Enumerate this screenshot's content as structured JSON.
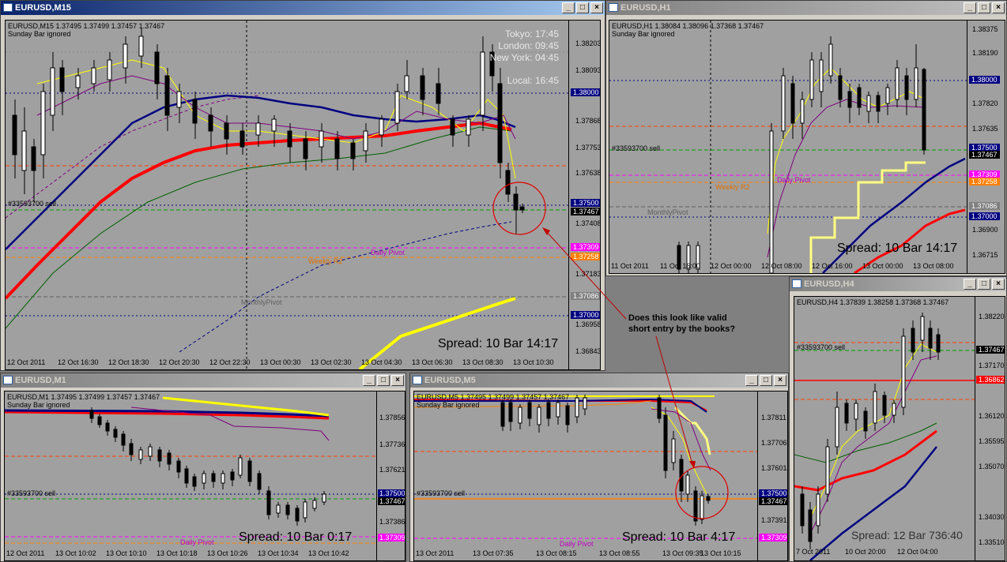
{
  "annotation": {
    "line1": "Does this look like valid",
    "line2": "short entry by the books?"
  },
  "windows": {
    "m15": {
      "title": "EURUSD,M15",
      "info1": "EURUSD,M15  1.37495 1.37499 1.37457 1.37467",
      "info2": "Sunday Bar ignored",
      "sessions": [
        "Tokyo: 17:45",
        "London: 09:45",
        "New York: 04:45",
        "Local: 16:45"
      ],
      "spread": "Spread: 10 Bar  14:17",
      "prices": [
        "1.38203",
        "1.38093",
        "1.37868",
        "1.37753",
        "1.37638",
        "1.37408",
        "1.37183",
        "1.36958",
        "1.36843"
      ],
      "tags": [
        "1.38000",
        "1.37500",
        "1.37467",
        "1.37309",
        "1.37258",
        "1.37086",
        "1.37000"
      ],
      "times": [
        "12 Oct 2011",
        "12 Oct 16:30",
        "12 Oct 18:30",
        "12 Oct 20:30",
        "12 Oct 22:30",
        "13 Oct 00:30",
        "13 Oct 02:30",
        "13 Oct 04:30",
        "13 Oct 06:30",
        "13 Oct 08:30",
        "13 Oct 10:30"
      ],
      "labels": {
        "sell": "#33593700 sell",
        "pivot": "Daily Pivot",
        "r2": "Weekly R2",
        "monthly": "MonthlyPivot"
      }
    },
    "h1": {
      "title": "EURUSD,H1",
      "info1": "EURUSD,H1  1.38084 1.38096 1.37368 1.37467",
      "info2": "Sunday Bar ignored",
      "spread": "Spread: 10 Bar  14:17",
      "prices": [
        "1.38375",
        "1.38190",
        "1.37820",
        "1.37635",
        "1.36900",
        "1.36715"
      ],
      "tags": [
        "1.38000",
        "1.37500",
        "1.37467",
        "1.37309",
        "1.37258",
        "1.37086",
        "1.37000"
      ],
      "times": [
        "11 Oct 2011",
        "11 Oct 16:00",
        "12 Oct 00:00",
        "12 Oct 08:00",
        "12 Oct 16:00",
        "13 Oct 00:00",
        "13 Oct 08:00"
      ],
      "labels": {
        "sell": "#33593700 sell",
        "pivot": "Daily Pivot",
        "r2": "Weekly R2",
        "monthly": "MonthlyPivot"
      }
    },
    "h4": {
      "title": "EURUSD,H4",
      "info1": "EURUSD,H4  1.37839 1.38258 1.37368 1.37467",
      "spread": "Spread: 12 Bar  736:40",
      "prices": [
        "1.38220",
        "1.37170",
        "1.36120",
        "1.35595",
        "1.35070",
        "1.34030",
        "1.33510"
      ],
      "tags": [
        "1.37467",
        "1.36862"
      ],
      "times": [
        "7 Oct 2011",
        "10 Oct 20:00",
        "12 Oct 04:00"
      ],
      "labels": {
        "sell": "#33593700 sell"
      }
    },
    "m1": {
      "title": "EURUSD,M1",
      "info1": "EURUSD,M1  1.37495 1.37499 1.37457 1.37467",
      "info2": "Sunday Bar ignored",
      "spread": "Spread: 10  Bar  0:17",
      "prices": [
        "1.37856",
        "1.37736",
        "1.37621",
        "1.37386"
      ],
      "tags": [
        "1.37500",
        "1.37467",
        "1.37309"
      ],
      "times": [
        "12 Oct 2011",
        "13 Oct 10:02",
        "13 Oct 10:10",
        "13 Oct 10:18",
        "13 Oct 10:26",
        "13 Oct 10:34",
        "13 Oct 10:42"
      ],
      "labels": {
        "sell": "#33593700 sell",
        "pivot": "Daily Pivot"
      }
    },
    "m5": {
      "title": "EURUSD,M5",
      "info1": "EURUSD,M5  1.37495 1.37499 1.37457 1.37467",
      "info2": "Sunday Bar ignored",
      "spread": "Spread: 10   Bar  4:17",
      "prices": [
        "1.37811",
        "1.37706",
        "1.37601",
        "1.37391"
      ],
      "tags": [
        "1.37500",
        "1.37467",
        "1.37309"
      ],
      "times": [
        "13 Oct 2011",
        "13 Oct 07:35",
        "13 Oct 08:15",
        "13 Oct 08:55",
        "13 Oct 09:35",
        "13 Oct 10:15"
      ],
      "labels": {
        "sell": "#33593700 sell",
        "pivot": "Daily Pivot"
      }
    }
  },
  "colors": {
    "title_active": "#0a246a",
    "chart_bg": "#a0a0a0",
    "ema_red": "#ff0000",
    "ema_blue": "#000080",
    "ema_yellow": "#ffff00",
    "pivot": "#ff00ff",
    "r2": "#ff8000",
    "tag_bg": "#000080"
  }
}
